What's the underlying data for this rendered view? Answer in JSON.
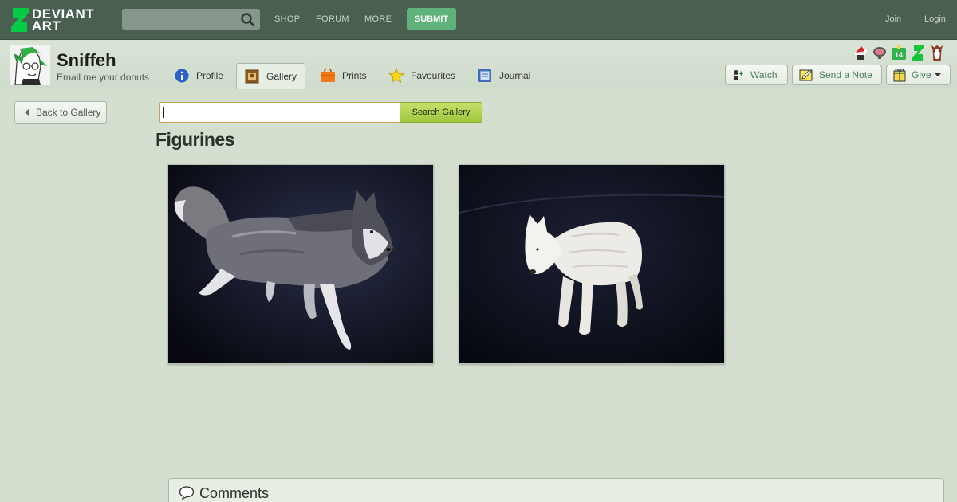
{
  "topbar": {
    "logo_text_line1": "DEVIANT",
    "logo_text_line2": "ART",
    "search_placeholder": "",
    "nav": [
      "SHOP",
      "FORUM",
      "MORE"
    ],
    "submit_label": "SUBMIT",
    "join_label": "Join",
    "login_label": "Login",
    "colors": {
      "bar": "#4b5f51",
      "submit": "#5fb37a"
    }
  },
  "profile": {
    "username": "Sniffeh",
    "tagline": "Email me your donuts",
    "tabs": [
      {
        "label": "Profile",
        "icon": "info-icon"
      },
      {
        "label": "Gallery",
        "icon": "gallery-icon",
        "active": true
      },
      {
        "label": "Prints",
        "icon": "prints-icon"
      },
      {
        "label": "Favourites",
        "icon": "star-icon"
      },
      {
        "label": "Journal",
        "icon": "journal-icon"
      }
    ],
    "badges": [
      "santa-badge",
      "brain-badge",
      "anniversary-badge",
      "devious-badge",
      "llama-badge"
    ],
    "badge_anniversary_text": "14",
    "buttons": {
      "watch": "Watch",
      "note": "Send a Note",
      "give": "Give"
    }
  },
  "gallery": {
    "back_label": "Back to Gallery",
    "search_value": "",
    "search_button": "Search Gallery",
    "folder_title": "Figurines",
    "thumbnails": [
      {
        "subject": "husky figurine"
      },
      {
        "subject": "white wolf figurine"
      }
    ]
  },
  "comments": {
    "title": "Comments"
  }
}
